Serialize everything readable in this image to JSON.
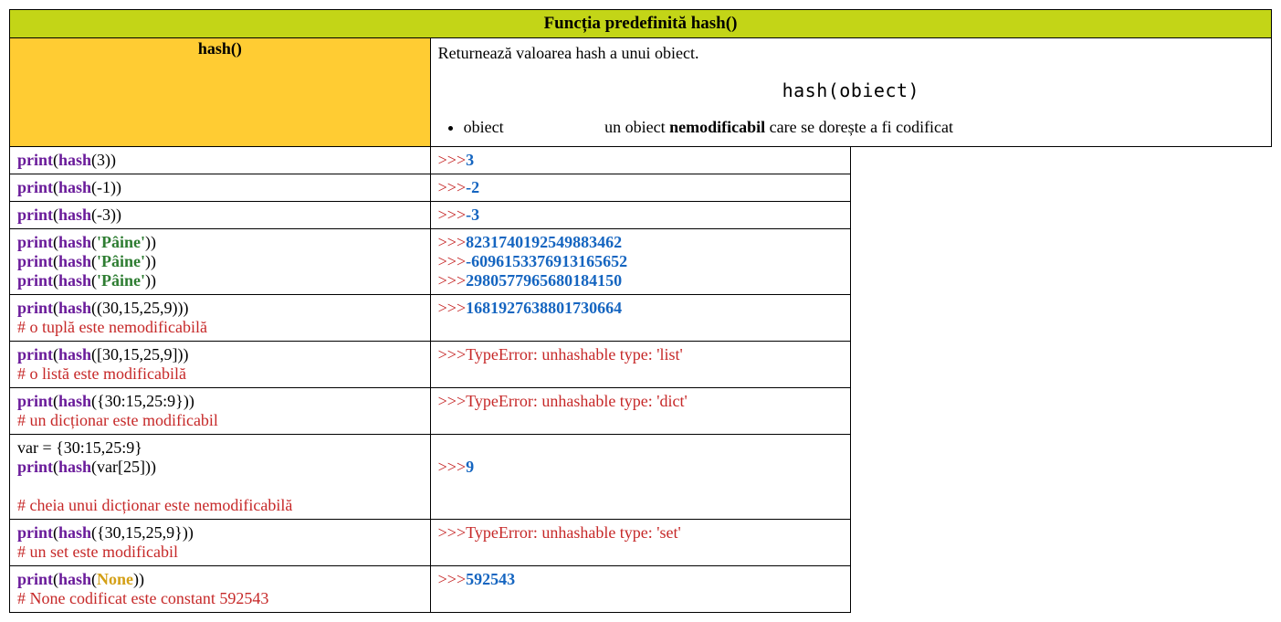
{
  "header": {
    "title": "Funcția predefinită hash()"
  },
  "side_label": "hash()",
  "description": {
    "summary": "Returnează valoarea hash a unui obiect.",
    "syntax": "hash(obiect)",
    "param_name": "obiect",
    "param_desc_prefix": "un obiect ",
    "param_desc_bold": "nemodificabil",
    "param_desc_suffix": " care se dorește a fi codificat"
  },
  "rows": [
    {
      "code_html": "<span class='kw'>print</span>(<span class='kw'>hash</span>(3))",
      "out_html": "<span class='prompt'>&gt;&gt;&gt;</span><span class='val'>3</span>"
    },
    {
      "code_html": "<span class='kw'>print</span>(<span class='kw'>hash</span>(-1))",
      "out_html": "<span class='prompt'>&gt;&gt;&gt;</span><span class='val'>-2</span>"
    },
    {
      "code_html": "<span class='kw'>print</span>(<span class='kw'>hash</span>(-3))",
      "out_html": "<span class='prompt'>&gt;&gt;&gt;</span><span class='val'>-3</span>"
    },
    {
      "code_html": "<span class='kw'>print</span>(<span class='kw'>hash</span>(<span class='str'>'Pâine'</span>))<br><span class='kw'>print</span>(<span class='kw'>hash</span>(<span class='str'>'Pâine'</span>))<br><span class='kw'>print</span>(<span class='kw'>hash</span>(<span class='str'>'Pâine'</span>))",
      "out_html": "<span class='prompt'>&gt;&gt;&gt;</span><span class='val'>8231740192549883462</span><br><span class='prompt'>&gt;&gt;&gt;</span><span class='val'>-6096153376913165652</span><br><span class='prompt'>&gt;&gt;&gt;</span><span class='val'>2980577965680184150</span>"
    },
    {
      "code_html": "<span class='code-col'><span class='kw'>print</span>(<span class='kw'>hash</span>((30,15,25,9)))</span><span class='comment-col comment'># o tuplă este nemodificabilă</span>",
      "out_html": "<span class='prompt'>&gt;&gt;&gt;</span><span class='val'>1681927638801730664</span>"
    },
    {
      "code_html": "<span class='code-col'><span class='kw'>print</span>(<span class='kw'>hash</span>([30,15,25,9]))</span><span class='comment-col comment'># o listă este modificabilă</span>",
      "out_html": "<span class='prompt'>&gt;&gt;&gt;</span><span class='err'>TypeError: unhashable type: 'list'</span>"
    },
    {
      "code_html": "<span class='code-col'><span class='kw'>print</span>(<span class='kw'>hash</span>({30:15,25:9}))</span><span class='comment-col comment'># un dicționar este modificabil</span>",
      "out_html": "<span class='prompt'>&gt;&gt;&gt;</span><span class='err'>TypeError: unhashable type: 'dict'</span>"
    },
    {
      "code_html": "<span class='code-col'>var = {30:15,25:9}<br><span class='kw'>print</span>(<span class='kw'>hash</span>(var[25]))</span><span class='comment-col comment'><br># cheia unui dicționar este nemodificabilă</span>",
      "out_html": "<br><span class='prompt'>&gt;&gt;&gt;</span><span class='val'>9</span>"
    },
    {
      "code_html": "<span class='code-col'><span class='kw'>print</span>(<span class='kw'>hash</span>({30,15,25,9}))</span><span class='comment-col comment'># un set este modificabil</span>",
      "out_html": "<span class='prompt'>&gt;&gt;&gt;</span><span class='err'>TypeError: unhashable type: 'set'</span>"
    },
    {
      "code_html": "<span class='code-col'><span class='kw'>print</span>(<span class='kw'>hash</span>(<span class='none'>None</span>))</span><span class='comment-col comment'># None codificat este constant 592543</span>",
      "out_html": "<span class='prompt'>&gt;&gt;&gt;</span><span class='val'>592543</span>"
    }
  ]
}
